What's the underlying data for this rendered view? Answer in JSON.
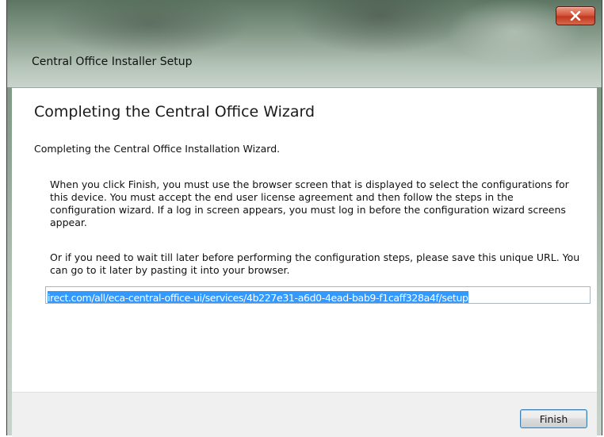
{
  "window": {
    "title": "Central Office Installer Setup",
    "close_icon": "close-icon",
    "close_glyph": "x"
  },
  "wizard": {
    "heading": "Completing the Central Office Wizard",
    "subheading": "Completing the Central Office Installation Wizard.",
    "paragraph1": "When you click Finish, you must use the browser screen that is displayed to select the configurations for this device. You must accept the end user license agreement and then follow the steps in the configuration wizard. If a log in screen appears, you must log in before the configuration wizard screens appear.",
    "paragraph2": "Or if you need to wait till later before performing the configuration steps, please save this unique URL. You can go to it later by pasting it into your browser.",
    "url_value": "irect.com/all/eca-central-office-ui/services/4b227e31-a6d0-4ead-bab9-f1caff328a4f/setup"
  },
  "footer": {
    "finish_label": "Finish"
  },
  "colors": {
    "selection": "#3399ff",
    "close_button": "#c8452b"
  }
}
